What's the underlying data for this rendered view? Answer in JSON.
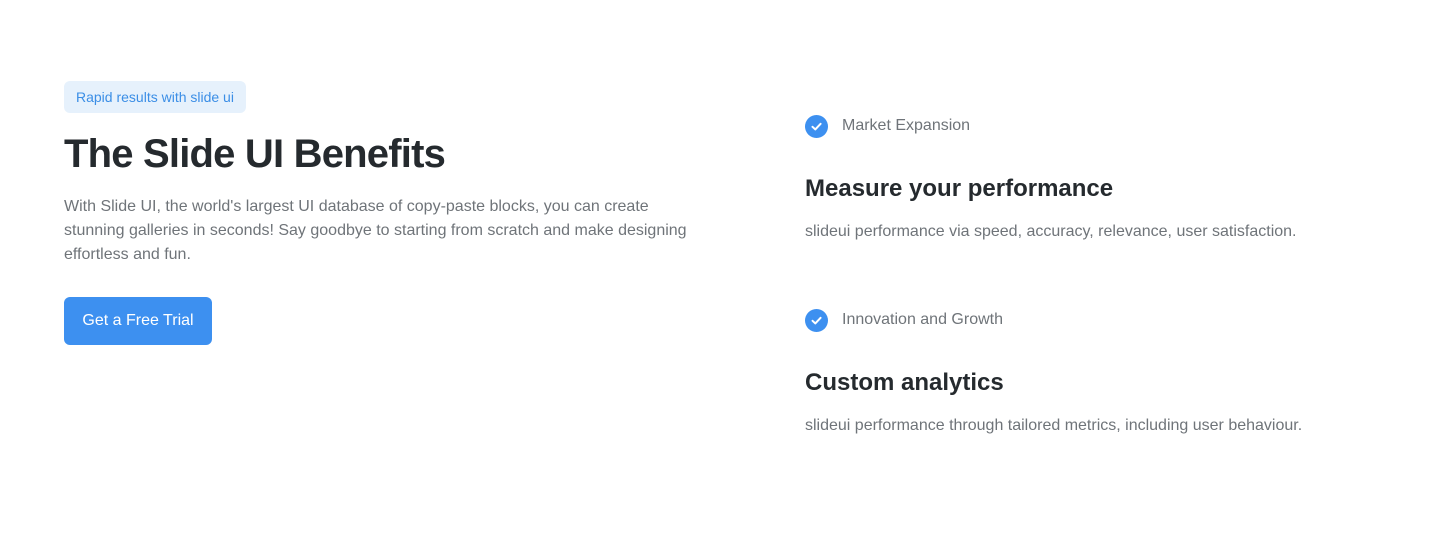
{
  "hero": {
    "badge": "Rapid results with slide ui",
    "title": "The Slide UI Benefits",
    "description": "With Slide UI, the world's largest UI database of copy-paste blocks, you can create stunning galleries in seconds! Say goodbye to starting from scratch and make designing effortless and fun.",
    "cta_label": "Get a Free Trial"
  },
  "features": [
    {
      "tag": "Market Expansion",
      "icon": "check-circle-icon",
      "title": "Measure your performance",
      "description": "slideui performance via speed, accuracy, relevance, user satisfaction."
    },
    {
      "tag": "Innovation and Growth",
      "icon": "check-circle-icon",
      "title": "Custom analytics",
      "description": "slideui performance through tailored metrics, including user behaviour."
    }
  ],
  "colors": {
    "accent": "#3d90f0",
    "badge_bg": "#e6f1fc",
    "heading": "#252a2e",
    "body_text": "#6f7479"
  }
}
